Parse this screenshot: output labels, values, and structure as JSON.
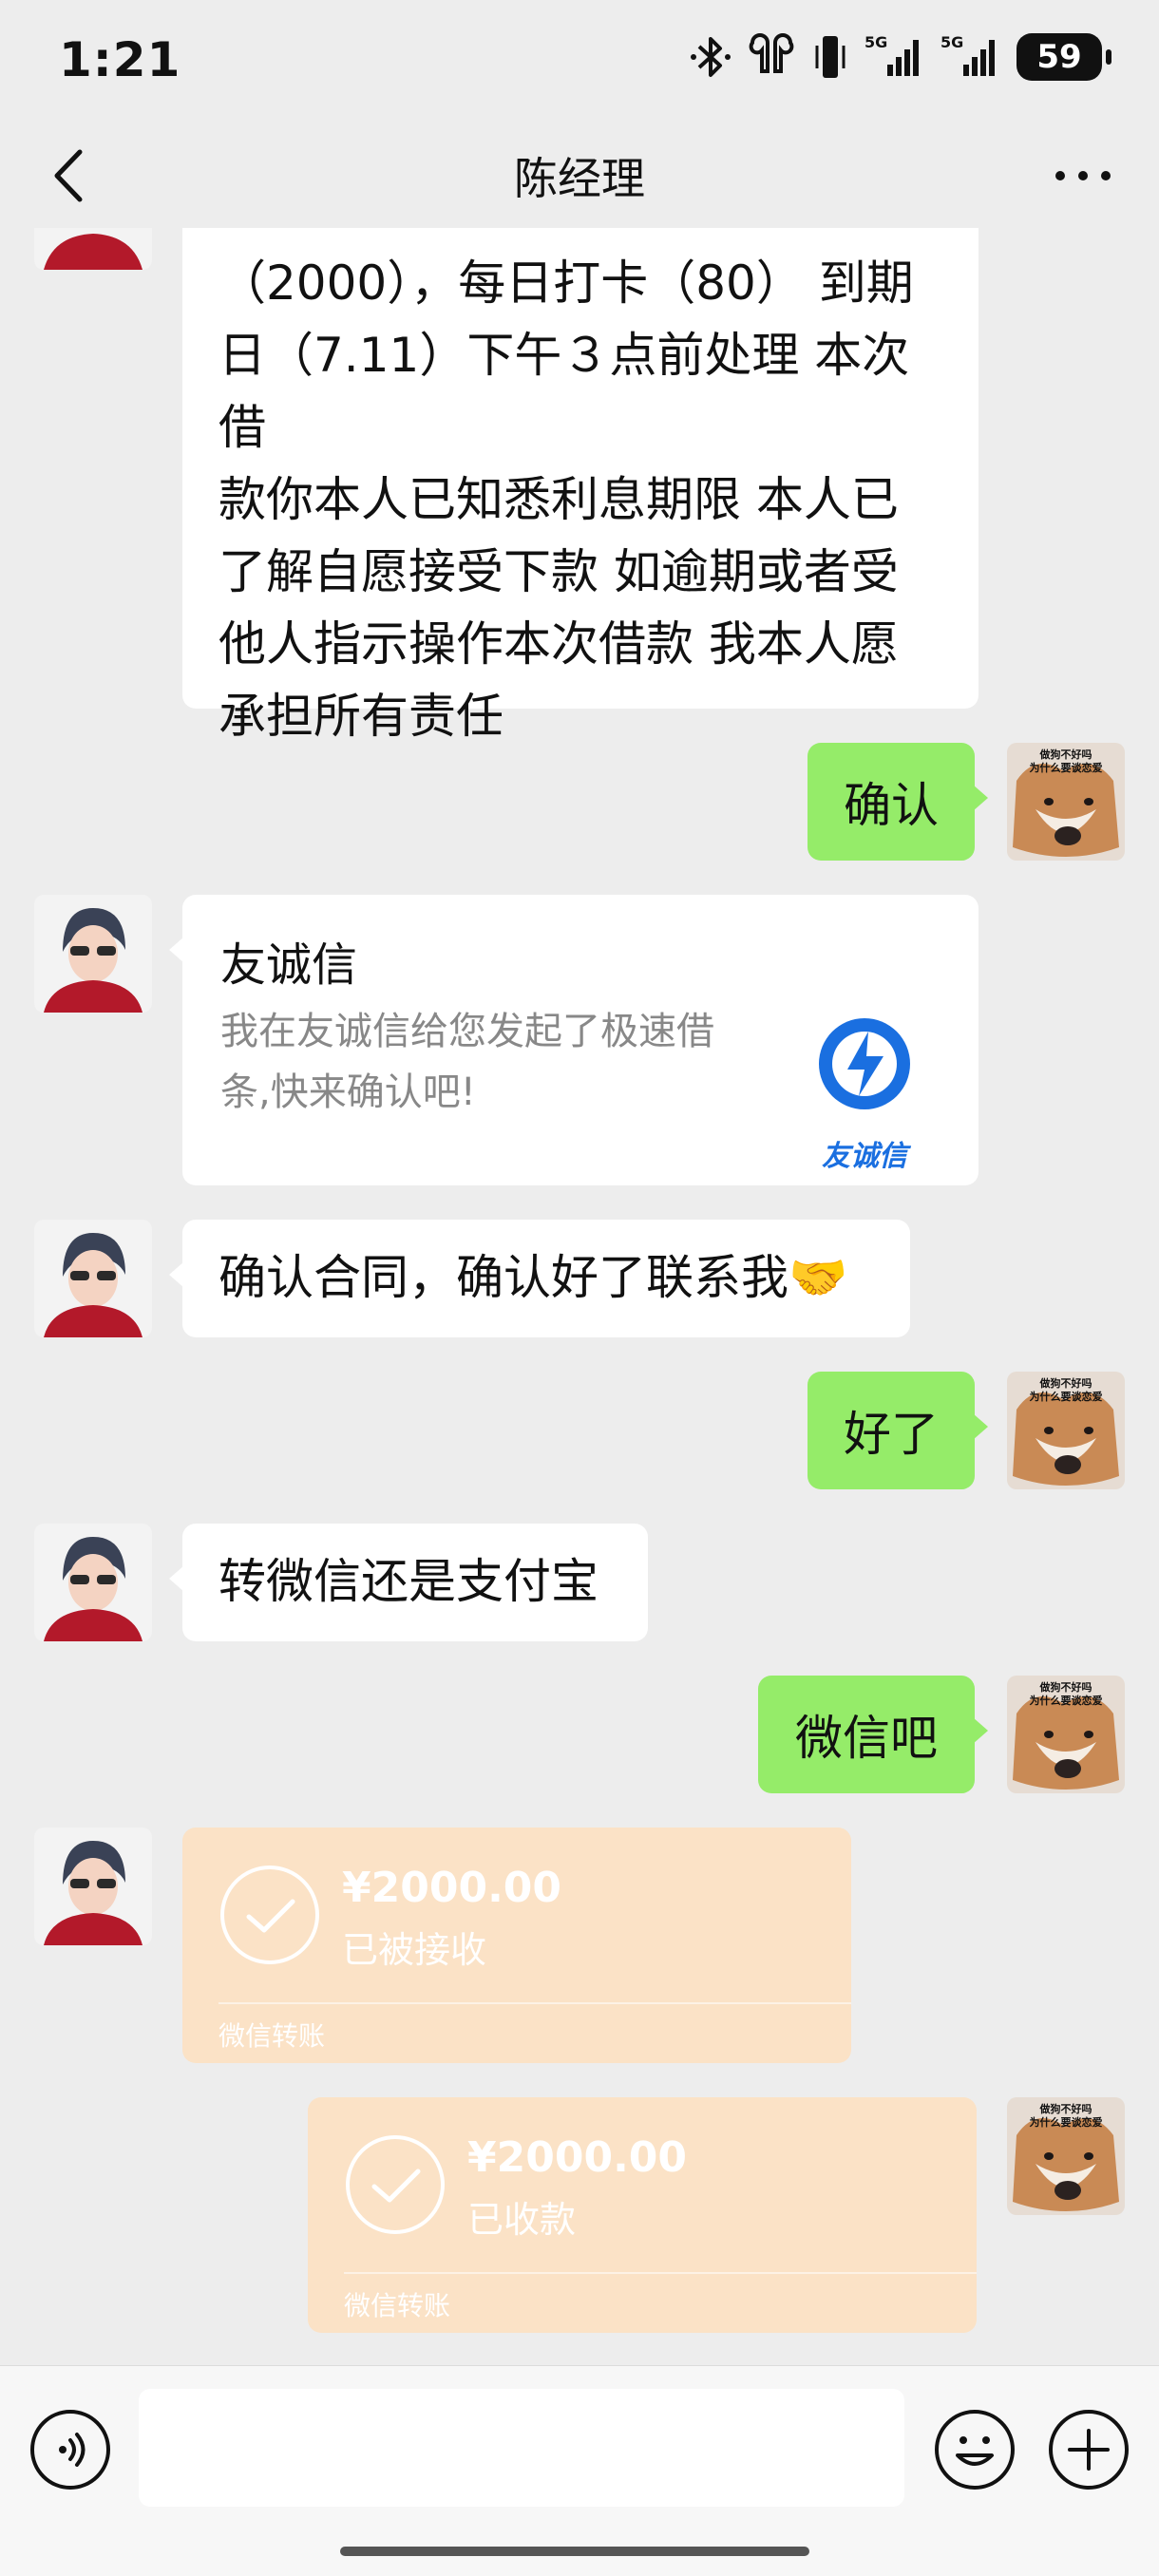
{
  "status_bar": {
    "time": "1:21",
    "battery": "59",
    "net1": "5G",
    "net2": "5G"
  },
  "nav": {
    "title": "陈经理"
  },
  "messages": {
    "m1": {
      "lines": [
        "（2000），每日打卡（80）   到期",
        "日（7.11）下午３点前处理  本次借",
        "款你本人已知悉利息期限  本人已",
        "了解自愿接受下款   如逾期或者受",
        "他人指示操作本次借款 我本人愿",
        "承担所有责任"
      ]
    },
    "m2": {
      "text": "确认"
    },
    "m3": {
      "title": "友诚信",
      "desc": "我在友诚信给您发起了极速借条,快来确认吧!",
      "logo_text": "友诚信"
    },
    "m4": {
      "text": "确认合同，确认好了联系我🤝"
    },
    "m5": {
      "text": "好了"
    },
    "m6": {
      "text": "转微信还是支付宝"
    },
    "m7": {
      "text": "微信吧"
    },
    "m8": {
      "amount": "¥2000.00",
      "status": "已被接收",
      "footer": "微信转账"
    },
    "m9": {
      "amount": "¥2000.00",
      "status": "已收款",
      "footer": "微信转账"
    },
    "sticker_text": "做狗不好吗\n为什么要谈恋爱"
  },
  "colors": {
    "background": "#ededed",
    "sent_bubble": "#95ec69",
    "transfer_card": "#fbe2c6",
    "brand_blue": "#1a6fe0"
  },
  "input": {
    "placeholder": ""
  }
}
